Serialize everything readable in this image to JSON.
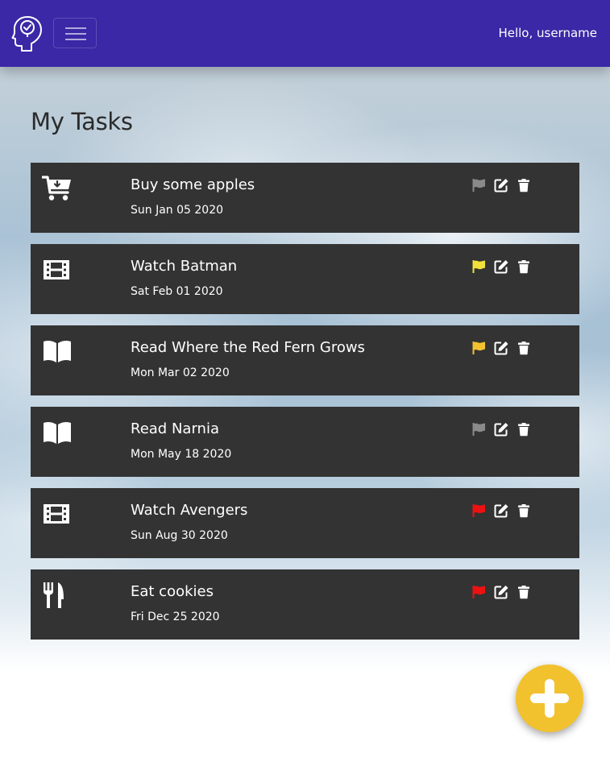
{
  "navbar": {
    "greeting": "Hello, username",
    "brand_icon": "head-check-logo",
    "menu_icon": "hamburger-icon",
    "background_color": "#3a28a6"
  },
  "main": {
    "title": "My Tasks"
  },
  "tasks": [
    {
      "icon": "cart-icon",
      "title": "Buy some apples",
      "date": "Sun Jan 05 2020",
      "priority": "none",
      "flag_color": "#8a8a8a"
    },
    {
      "icon": "film-icon",
      "title": "Watch Batman",
      "date": "Sat Feb 01 2020",
      "priority": "low",
      "flag_color": "#f2e03a"
    },
    {
      "icon": "book-icon",
      "title": "Read Where the Red Fern Grows",
      "date": "Mon Mar 02 2020",
      "priority": "medium",
      "flag_color": "#f2c12e"
    },
    {
      "icon": "book-icon",
      "title": "Read Narnia",
      "date": "Mon May 18 2020",
      "priority": "none",
      "flag_color": "#8a8a8a"
    },
    {
      "icon": "film-icon",
      "title": "Watch Avengers",
      "date": "Sun Aug 30 2020",
      "priority": "high",
      "flag_color": "#ee1111"
    },
    {
      "icon": "utensils-icon",
      "title": "Eat cookies",
      "date": "Fri Dec 25 2020",
      "priority": "high",
      "flag_color": "#ee1111"
    }
  ],
  "fab": {
    "icon": "plus-icon",
    "color": "#f2c12e"
  }
}
